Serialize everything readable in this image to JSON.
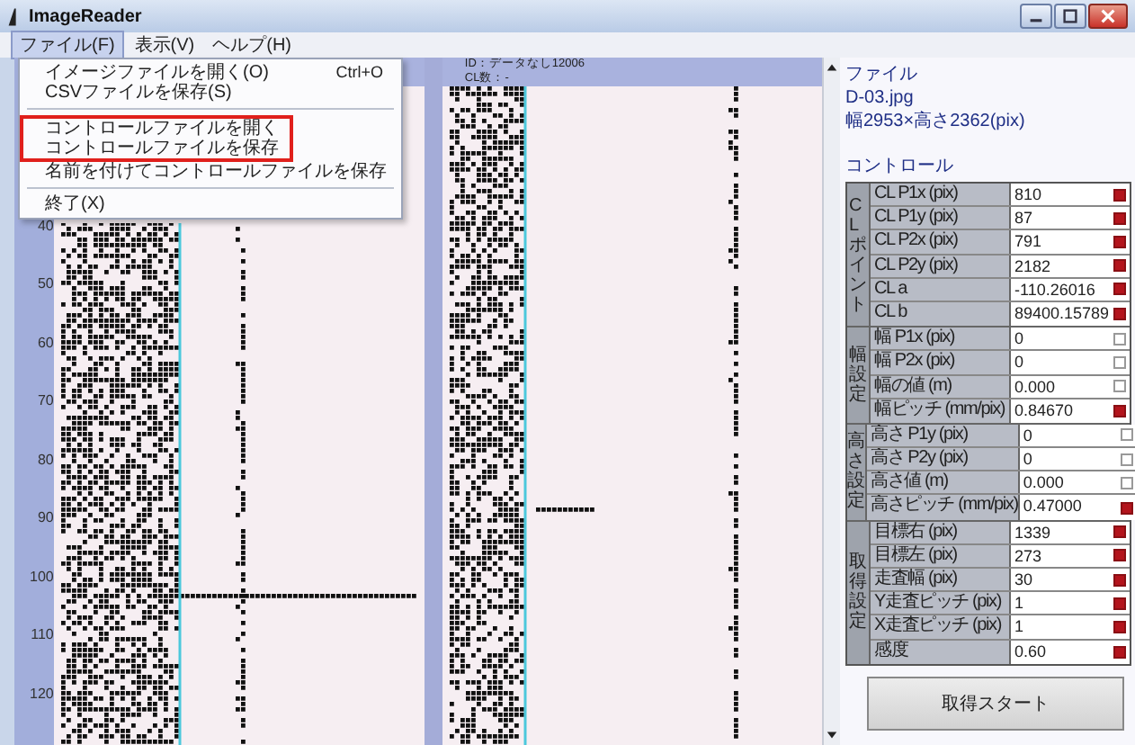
{
  "window": {
    "title": "ImageReader"
  },
  "menu_bar": [
    {
      "label": "ファイル(F)",
      "selected": true
    },
    {
      "label": "表示(V)",
      "selected": false
    },
    {
      "label": "ヘルプ(H)",
      "selected": false
    }
  ],
  "file_menu": [
    {
      "kind": "item",
      "label": "イメージファイルを開く(O)",
      "shortcut": "Ctrl+O",
      "highlighted": false
    },
    {
      "kind": "item",
      "label": "CSVファイルを保存(S)",
      "highlighted": false
    },
    {
      "kind": "separator"
    },
    {
      "kind": "item",
      "label": "コントロールファイルを開く",
      "highlighted": true
    },
    {
      "kind": "item",
      "label": "コントロールファイルを保存",
      "highlighted": true
    },
    {
      "kind": "item",
      "label": "名前を付けてコントロールファイルを保存",
      "highlighted": false
    },
    {
      "kind": "separator"
    },
    {
      "kind": "item",
      "label": "終了(X)",
      "highlighted": false
    }
  ],
  "row_numbers": [
    "40",
    "50",
    "60",
    "70",
    "80",
    "90",
    "100",
    "110",
    "120"
  ],
  "image_2_header": [
    "ID：データなし12006",
    "CL数：-"
  ],
  "file_info": {
    "heading": "ファイル",
    "name": "D-03.jpg",
    "size": "幅2953×高さ2362(pix)"
  },
  "controls": {
    "heading": "コントロール",
    "groups": [
      {
        "label": "CLポイント",
        "rows": [
          {
            "name": "CL P1x (pix)",
            "value": "810",
            "checked": true
          },
          {
            "name": "CL P1y (pix)",
            "value": "87",
            "checked": true
          },
          {
            "name": "CL P2x (pix)",
            "value": "791",
            "checked": true
          },
          {
            "name": "CL P2y (pix)",
            "value": "2182",
            "checked": true
          },
          {
            "name": "CL a",
            "value": "-110.26016",
            "checked": true
          },
          {
            "name": "CL b",
            "value": "89400.15789",
            "checked": true
          }
        ]
      },
      {
        "label": "幅設定",
        "rows": [
          {
            "name": "幅 P1x (pix)",
            "value": "0",
            "checked": false
          },
          {
            "name": "幅 P2x (pix)",
            "value": "0",
            "checked": false
          },
          {
            "name": "幅の値 (m)",
            "value": "0.000",
            "checked": false
          },
          {
            "name": "幅ピッチ (mm/pix)",
            "value": "0.84670",
            "checked": true
          }
        ]
      },
      {
        "label": "高さ設定",
        "rows": [
          {
            "name": "高さ P1y (pix)",
            "value": "0",
            "checked": false
          },
          {
            "name": "高さ P2y (pix)",
            "value": "0",
            "checked": false
          },
          {
            "name": "高さ値 (m)",
            "value": "0.000",
            "checked": false
          },
          {
            "name": "高さピッチ (mm/pix)",
            "value": "0.47000",
            "checked": true
          }
        ]
      },
      {
        "label": "取得設定",
        "rows": [
          {
            "name": "目標右 (pix)",
            "value": "1339",
            "checked": true
          },
          {
            "name": "目標左 (pix)",
            "value": "273",
            "checked": true
          },
          {
            "name": "走査幅 (pix)",
            "value": "30",
            "checked": true
          },
          {
            "name": "Y走査ピッチ (pix)",
            "value": "1",
            "checked": true
          },
          {
            "name": "X走査ピッチ (pix)",
            "value": "1",
            "checked": true
          },
          {
            "name": "感度",
            "value": "0.60",
            "checked": true
          }
        ]
      }
    ]
  },
  "start_button": "取得スタート"
}
